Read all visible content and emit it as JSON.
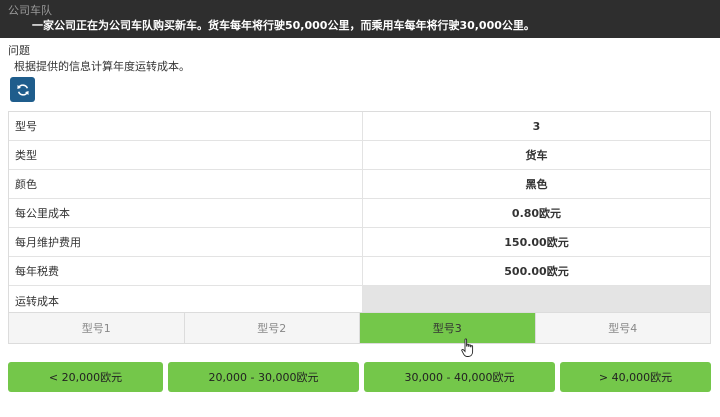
{
  "header": {
    "title": "公司车队",
    "description": "一家公司正在为公司车队购买新车。货车每年将行驶50,000公里，而乘用车每年将行驶30,000公里。"
  },
  "question": {
    "label": "问题",
    "text": "根据提供的信息计算年度运转成本。"
  },
  "refresh": {
    "icon": "refresh-icon",
    "color": "#1f5d8c"
  },
  "table": {
    "rows": [
      {
        "label": "型号",
        "value": "3"
      },
      {
        "label": "类型",
        "value": "货车"
      },
      {
        "label": "颜色",
        "value": "黑色"
      },
      {
        "label": "每公里成本",
        "value": "0.80欧元"
      },
      {
        "label": "每月维护费用",
        "value": "150.00欧元"
      },
      {
        "label": "每年税费",
        "value": "500.00欧元"
      },
      {
        "label": "运转成本",
        "value": ""
      }
    ]
  },
  "tabs": [
    {
      "label": "型号1",
      "active": false
    },
    {
      "label": "型号2",
      "active": false
    },
    {
      "label": "型号3",
      "active": true
    },
    {
      "label": "型号4",
      "active": false
    }
  ],
  "answers": [
    {
      "label": "< 20,000欧元"
    },
    {
      "label": "20,000 - 30,000欧元"
    },
    {
      "label": "30,000 - 40,000欧元"
    },
    {
      "label": "> 40,000欧元"
    }
  ],
  "colors": {
    "accent_green": "#74c74a",
    "header_bg": "#2e2e2e",
    "button_blue": "#1f5d8c"
  }
}
